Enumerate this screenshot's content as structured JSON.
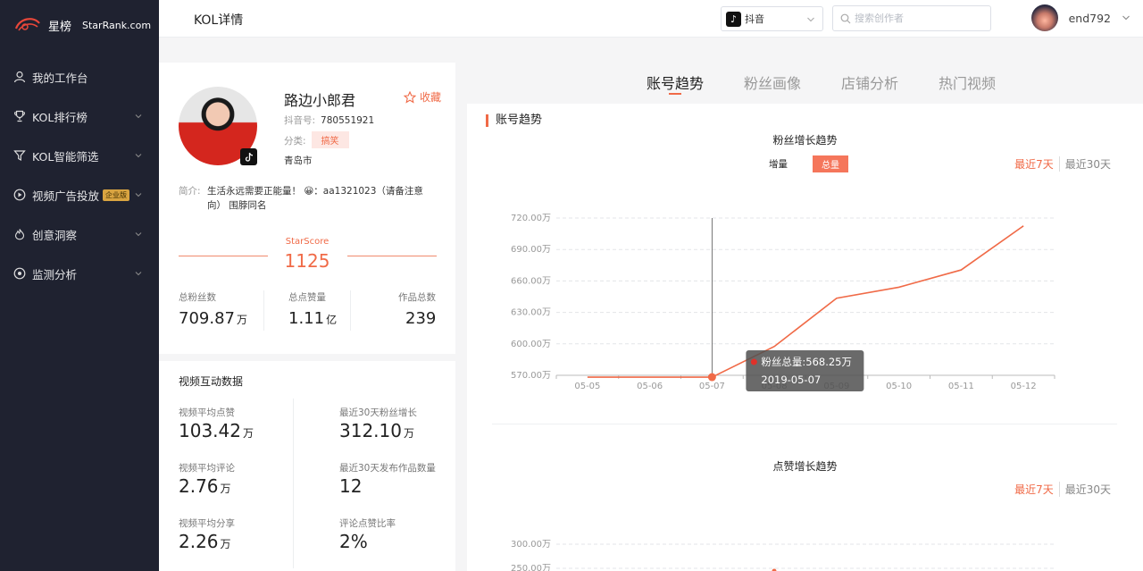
{
  "brand": {
    "name_cn": "星榜",
    "name_en": "StarRank.com"
  },
  "sidebar": {
    "items": [
      {
        "label": "我的工作台",
        "icon": "user-icon",
        "chevron": false
      },
      {
        "label": "KOL排行榜",
        "icon": "trophy-icon",
        "chevron": true
      },
      {
        "label": "KOL智能筛选",
        "icon": "filter-icon",
        "chevron": true
      },
      {
        "label": "视频广告投放",
        "icon": "play-circle-icon",
        "chevron": true,
        "badge": "企业版"
      },
      {
        "label": "创意洞察",
        "icon": "flame-icon",
        "chevron": true
      },
      {
        "label": "监测分析",
        "icon": "target-icon",
        "chevron": true
      }
    ]
  },
  "header": {
    "title": "KOL详情",
    "platform": "抖音",
    "search_placeholder": "搜索创作者",
    "username": "end792"
  },
  "profile": {
    "name": "路边小郎君",
    "favorite_label": "收藏",
    "id_label": "抖音号:",
    "id_value": "780551921",
    "category_label": "分类:",
    "category_value": "搞笑",
    "city": "青岛市",
    "bio_label": "简介:",
    "bio": "生活永远需要正能量！ 😀：aa1321023（请备注意向） 围脖同名",
    "starscore_label": "StarScore",
    "starscore": "1125",
    "stats": [
      {
        "label": "总粉丝数",
        "value": "709.87",
        "unit": "万"
      },
      {
        "label": "总点赞量",
        "value": "1.11",
        "unit": "亿"
      },
      {
        "label": "作品总数",
        "value": "239",
        "unit": ""
      }
    ]
  },
  "interaction": {
    "title": "视频互动数据",
    "items": [
      {
        "label": "视频平均点赞",
        "value": "103.42",
        "unit": "万"
      },
      {
        "label": "最近30天粉丝增长",
        "value": "312.10",
        "unit": "万"
      },
      {
        "label": "视频平均评论",
        "value": "2.76",
        "unit": "万"
      },
      {
        "label": "最近30天发布作品数量",
        "value": "12",
        "unit": ""
      },
      {
        "label": "视频平均分享",
        "value": "2.26",
        "unit": "万"
      },
      {
        "label": "评论点赞比率",
        "value": "2%",
        "unit": ""
      }
    ]
  },
  "tabs": [
    {
      "label": "账号趋势",
      "active": true
    },
    {
      "label": "粉丝画像",
      "active": false
    },
    {
      "label": "店铺分析",
      "active": false
    },
    {
      "label": "热门视频",
      "active": false
    }
  ],
  "section_title": "账号趋势",
  "fans_chart": {
    "title": "粉丝增长趋势",
    "mode_label": "增量",
    "mode_active": "总量",
    "range_7": "最近7天",
    "range_30": "最近30天",
    "tooltip_value": "粉丝总量:568.25万",
    "tooltip_date": "2019-05-07"
  },
  "likes_chart": {
    "title": "点赞增长趋势",
    "range_7": "最近7天",
    "range_30": "最近30天",
    "y_ticks": [
      "300.00万",
      "250.00万"
    ]
  },
  "chart_data": {
    "type": "line",
    "title": "粉丝增长趋势",
    "x": [
      "05-05",
      "05-06",
      "05-07",
      "05-08",
      "05-09",
      "05-10",
      "05-11",
      "05-12"
    ],
    "series": [
      {
        "values": [
          568.25,
          568.25,
          568.25,
          597.5,
          643.5,
          654.0,
          670.5,
          712.5
        ]
      }
    ],
    "y_ticks": [
      "570.00万",
      "600.00万",
      "630.00万",
      "660.00万",
      "690.00万",
      "720.00万"
    ],
    "ylim": [
      570,
      720
    ],
    "grid": true,
    "color": "#f06a47"
  },
  "colors": {
    "accent": "#f06a47",
    "sidebar_bg": "#1f2230"
  }
}
